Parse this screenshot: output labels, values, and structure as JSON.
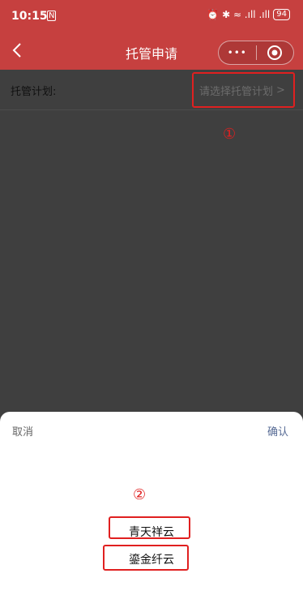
{
  "status_bar": {
    "time": "10:15",
    "nfc_label": "N",
    "signal_text": "⏰ ✱ ≈ .ıll .ıll",
    "battery": "94"
  },
  "nav": {
    "title": "托管申请",
    "more_glyph": "•••"
  },
  "form": {
    "label": "托管计划:",
    "placeholder": "请选择托管计划",
    "chevron": ">"
  },
  "annotations": {
    "marker1": "①",
    "marker2": "②",
    "color": "#e02020"
  },
  "picker": {
    "cancel": "取消",
    "confirm": "确认",
    "options": [
      "青天祥云",
      "鎏金纤云"
    ]
  },
  "colors": {
    "nav_bg": "#c6403f",
    "overlay": "#3f3f3f",
    "confirm": "#576b95"
  }
}
